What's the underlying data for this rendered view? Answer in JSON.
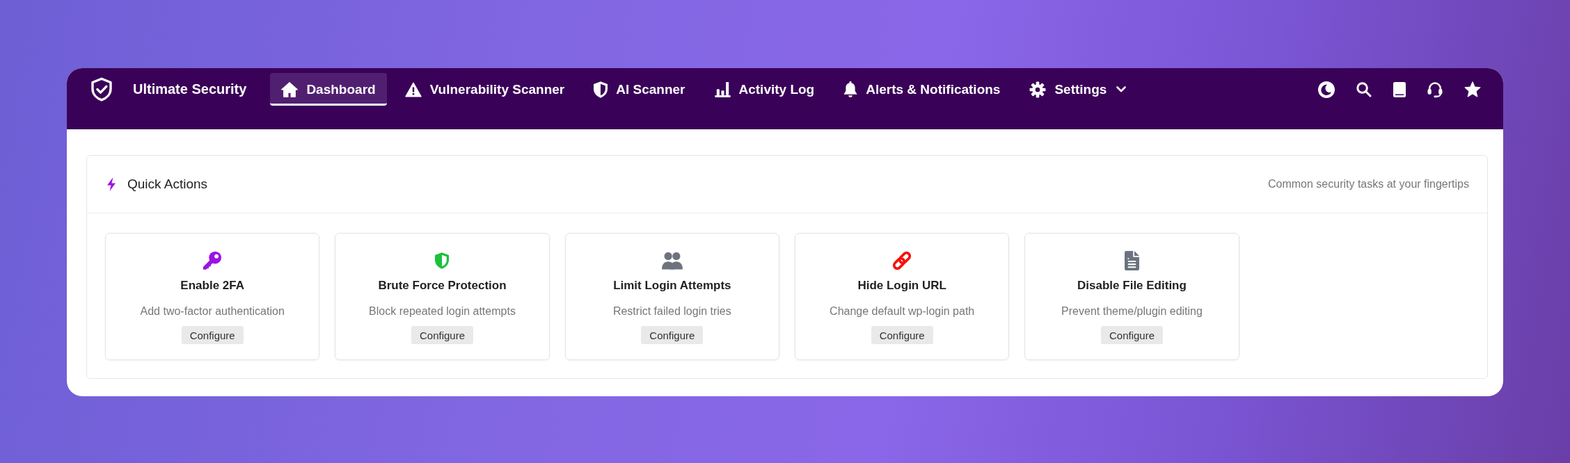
{
  "brand": {
    "name": "Ultimate Security"
  },
  "nav": [
    {
      "label": "Dashboard",
      "kind": "link",
      "selected": true
    },
    {
      "label": "Vulnerability Scanner",
      "kind": "link",
      "selected": false
    },
    {
      "label": "AI Scanner",
      "kind": "link",
      "selected": false
    },
    {
      "label": "Activity Log",
      "kind": "link",
      "selected": false
    },
    {
      "label": "Alerts & Notifications",
      "kind": "link",
      "selected": false
    },
    {
      "label": "Settings",
      "kind": "dropdown",
      "selected": false
    }
  ],
  "quick_actions": {
    "title": "Quick Actions",
    "subtitle": "Common security tasks at your fingertips",
    "actions": [
      {
        "title": "Enable 2FA",
        "description": "Add two-factor authentication",
        "button": "Configure",
        "color": "#9b12e6"
      },
      {
        "title": "Brute Force Protection",
        "description": "Block repeated login attempts",
        "button": "Configure",
        "color": "#1cc03c"
      },
      {
        "title": "Limit Login Attempts",
        "description": "Restrict failed login tries",
        "button": "Configure",
        "color": "#6c737f"
      },
      {
        "title": "Hide Login URL",
        "description": "Change default wp-login path",
        "button": "Configure",
        "color": "#f5120f"
      },
      {
        "title": "Disable File Editing",
        "description": "Prevent theme/plugin editing",
        "button": "Configure",
        "color": "#6c737f"
      }
    ]
  }
}
